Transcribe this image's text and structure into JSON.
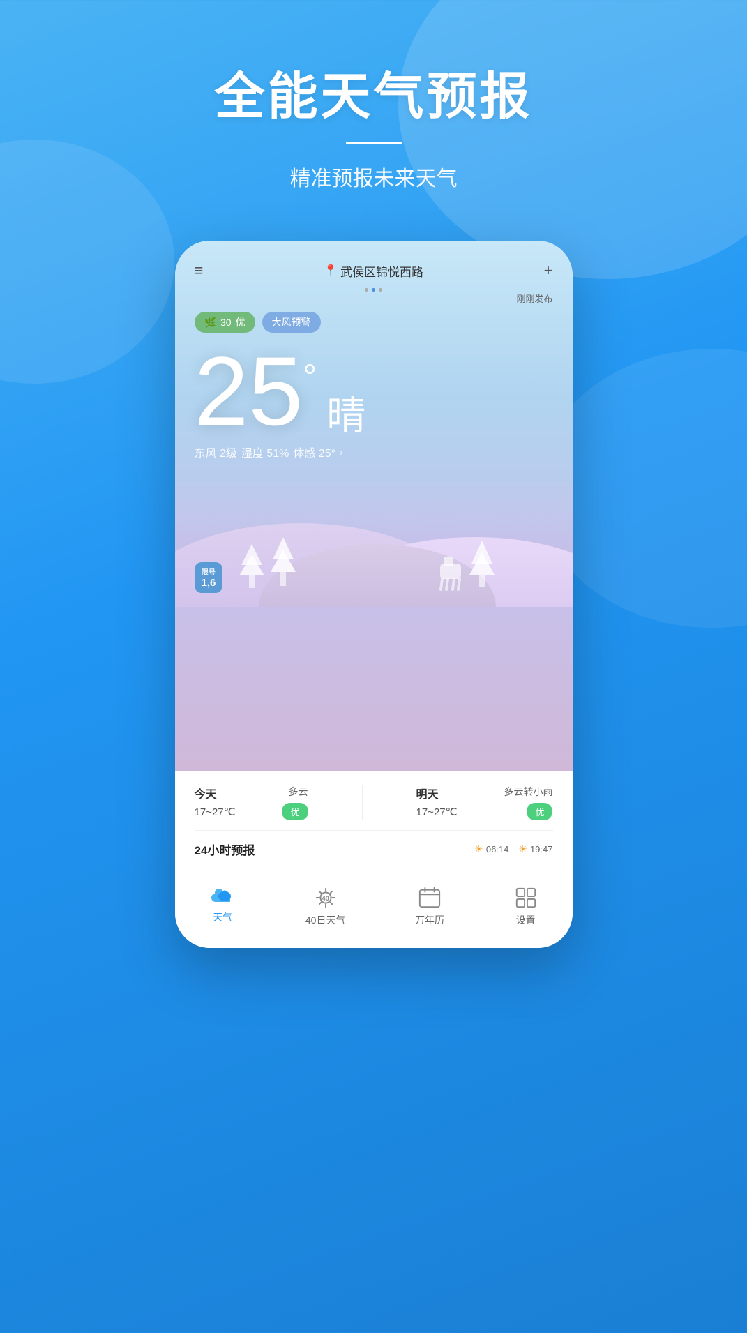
{
  "app": {
    "background_gradient_start": "#4ab3f4",
    "background_gradient_end": "#1a7fd4"
  },
  "header": {
    "title": "全能天气预报",
    "divider": true,
    "subtitle": "精准预报未来天气"
  },
  "phone": {
    "topbar": {
      "menu_icon": "≡",
      "location_icon": "📍",
      "location_name": "武侯区锦悦西路",
      "plus_icon": "+",
      "dots": [
        false,
        true,
        false
      ],
      "published_time": "刚刚发布"
    },
    "badges": {
      "aqi_value": "30",
      "aqi_level": "优",
      "wind_warning": "大风预警"
    },
    "weather": {
      "temperature": "25",
      "degree_symbol": "°",
      "condition": "晴",
      "wind": "东风 2级",
      "humidity": "湿度 51%",
      "feel_temp": "体感 25°"
    },
    "license": {
      "label": "限号",
      "number": "1,6"
    },
    "forecast": {
      "today": {
        "day": "今天",
        "condition": "多云",
        "temp_range": "17~27℃",
        "quality": "优"
      },
      "tomorrow": {
        "day": "明天",
        "condition": "多云转小雨",
        "temp_range": "17~27℃",
        "quality": "优"
      }
    },
    "forecast24": {
      "title": "24小时预报",
      "sunrise": "06:14",
      "sunset": "19:47"
    }
  },
  "bottom_nav": {
    "items": [
      {
        "label": "天气",
        "icon": "cloud",
        "active": true
      },
      {
        "label": "40日天气",
        "icon": "sun40",
        "active": false
      },
      {
        "label": "万年历",
        "icon": "calendar",
        "active": false
      },
      {
        "label": "设置",
        "icon": "grid",
        "active": false
      }
    ]
  }
}
